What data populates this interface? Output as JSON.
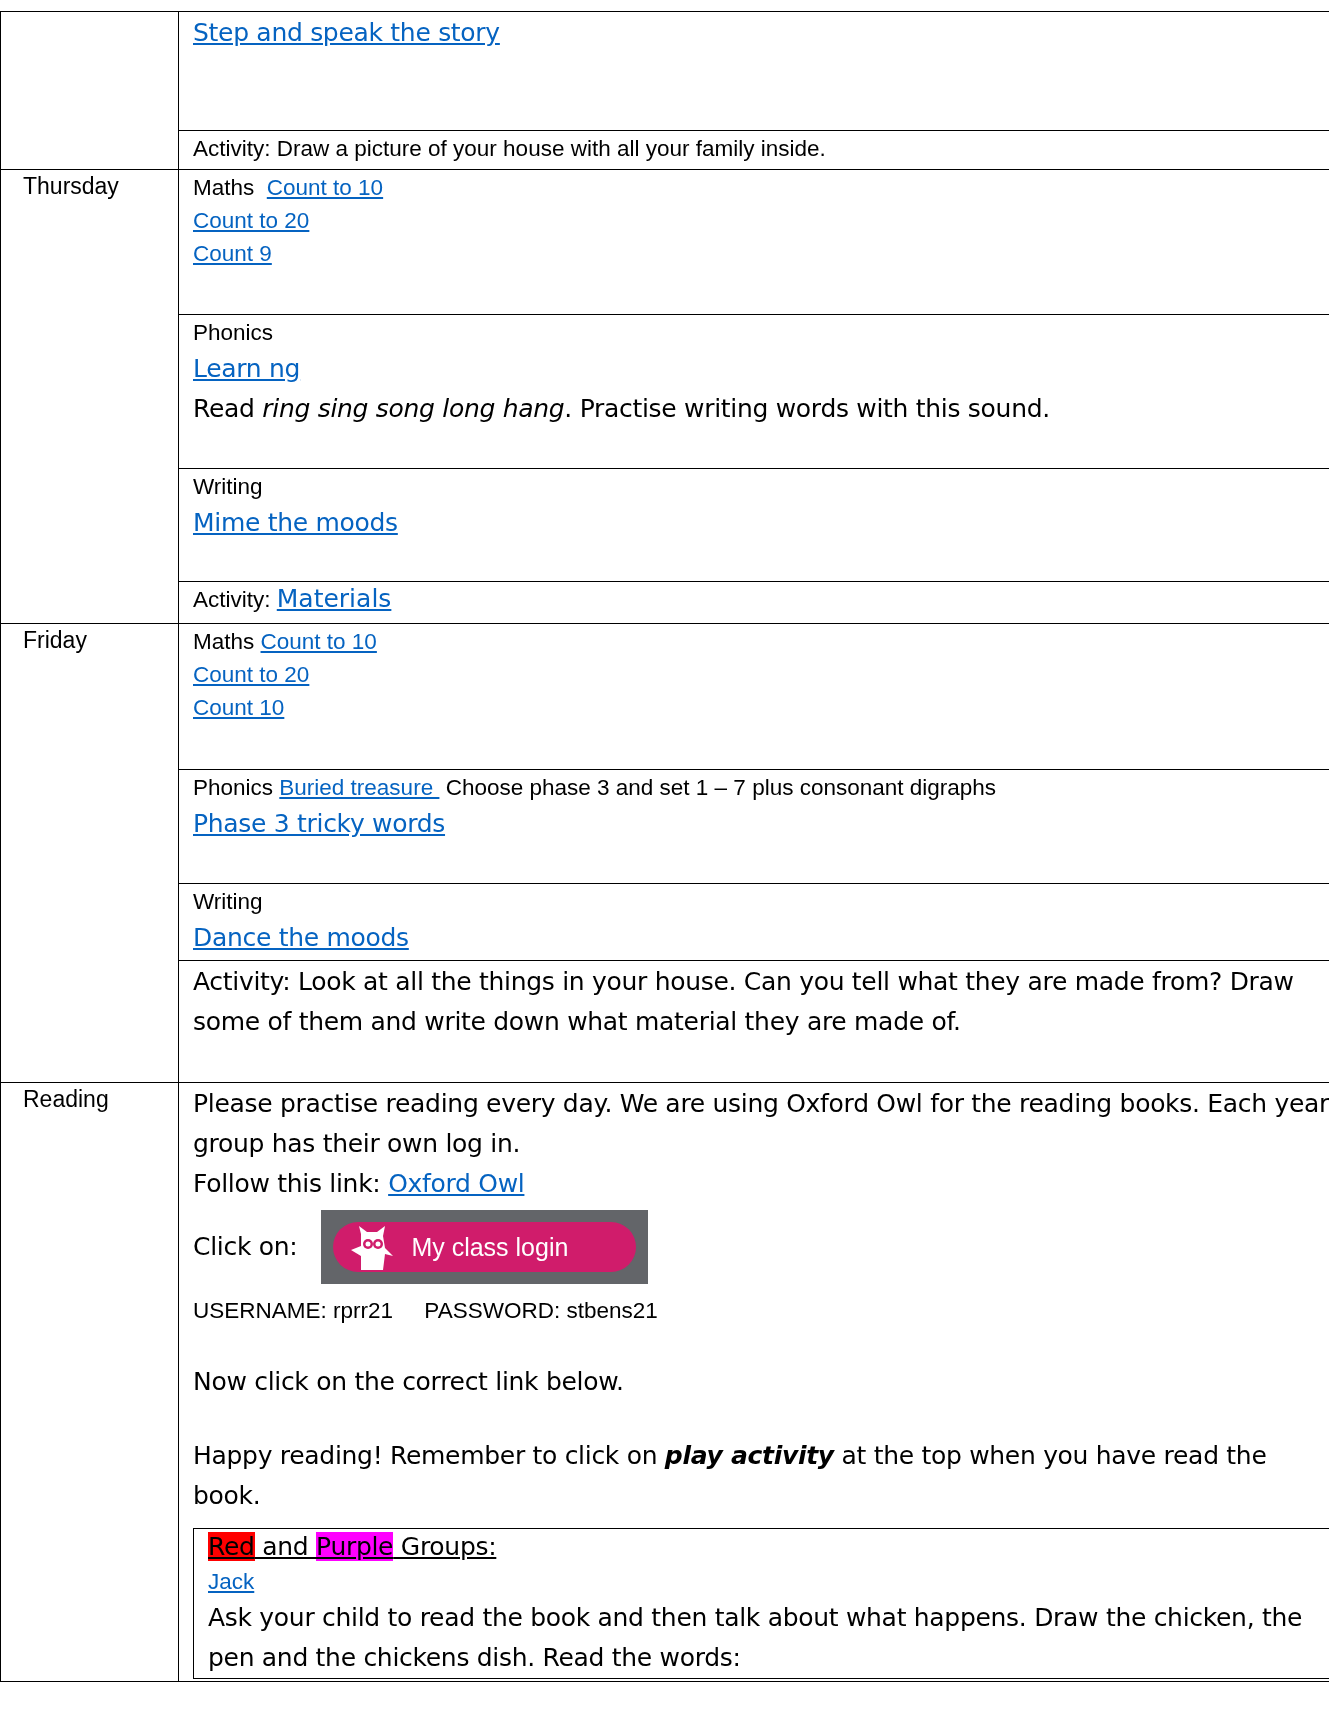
{
  "rows": [
    {
      "cells": [
        {
          "paragraphs": [
            {
              "kind": "large",
              "segments": [
                {
                  "kind": "link",
                  "text": "Step and speak the story"
                }
              ]
            }
          ]
        },
        {
          "paragraphs": [
            {
              "kind": "small",
              "segments": [
                {
                  "kind": "text",
                  "text": "Activity: Draw a picture of your house with all your family inside."
                }
              ]
            }
          ]
        }
      ]
    },
    {
      "day": "Thursday",
      "cells": [
        {
          "paragraphs": [
            {
              "kind": "small",
              "segments": [
                {
                  "kind": "text",
                  "text": "Maths  "
                },
                {
                  "kind": "link",
                  "text": "Count to 10"
                }
              ]
            },
            {
              "kind": "small",
              "segments": [
                {
                  "kind": "link",
                  "text": "Count to 20"
                }
              ]
            },
            {
              "kind": "small",
              "segments": [
                {
                  "kind": "link",
                  "text": "Count 9"
                }
              ]
            }
          ]
        },
        {
          "paragraphs": [
            {
              "kind": "small",
              "segments": [
                {
                  "kind": "text",
                  "text": "Phonics"
                }
              ]
            },
            {
              "kind": "large",
              "segments": [
                {
                  "kind": "link",
                  "text": "Learn ng"
                }
              ]
            },
            {
              "kind": "large",
              "segments": [
                {
                  "kind": "text",
                  "text": "Read "
                },
                {
                  "kind": "italic",
                  "text": "ring sing song long hang"
                },
                {
                  "kind": "text",
                  "text": ". Practise writing words with this sound."
                }
              ]
            }
          ]
        },
        {
          "paragraphs": [
            {
              "kind": "small",
              "segments": [
                {
                  "kind": "text",
                  "text": "Writing"
                }
              ]
            },
            {
              "kind": "large",
              "segments": [
                {
                  "kind": "link",
                  "text": "Mime the moods"
                }
              ]
            }
          ]
        },
        {
          "paragraphs": [
            {
              "kind": "small",
              "segments": [
                {
                  "kind": "text",
                  "text": "Activity: "
                },
                {
                  "kind": "biglink",
                  "text": "Materials"
                }
              ]
            }
          ]
        }
      ]
    },
    {
      "day": "Friday",
      "cells": [
        {
          "paragraphs": [
            {
              "kind": "small",
              "segments": [
                {
                  "kind": "text",
                  "text": "Maths "
                },
                {
                  "kind": "link",
                  "text": "Count to 10"
                }
              ]
            },
            {
              "kind": "small",
              "segments": [
                {
                  "kind": "link",
                  "text": "Count to 20"
                }
              ]
            },
            {
              "kind": "small",
              "segments": [
                {
                  "kind": "link",
                  "text": "Count 10"
                }
              ]
            }
          ]
        },
        {
          "paragraphs": [
            {
              "kind": "small",
              "segments": [
                {
                  "kind": "text",
                  "text": "Phonics "
                },
                {
                  "kind": "link",
                  "text": "Buried treasure "
                },
                {
                  "kind": "text",
                  "text": " Choose phase 3 and set 1 – 7 plus consonant digraphs"
                }
              ]
            },
            {
              "kind": "large",
              "segments": [
                {
                  "kind": "link",
                  "text": "Phase 3 tricky words"
                }
              ]
            }
          ]
        },
        {
          "paragraphs": [
            {
              "kind": "small",
              "segments": [
                {
                  "kind": "text",
                  "text": "Writing"
                }
              ]
            },
            {
              "kind": "large",
              "segments": [
                {
                  "kind": "link",
                  "text": "Dance the moods"
                }
              ]
            }
          ]
        },
        {
          "paragraphs": [
            {
              "kind": "large",
              "segments": [
                {
                  "kind": "text",
                  "text": "Activity: Look at all the things in your house. Can you tell what they are made from? Draw some of them and write down what material they are made of."
                }
              ]
            }
          ]
        }
      ]
    },
    {
      "day": "Reading",
      "cells": [
        {
          "paragraphs": [
            {
              "kind": "large",
              "segments": [
                {
                  "kind": "text",
                  "text": "Please practise reading every day. We are using Oxford Owl for the reading books. Each year group has their own log in."
                }
              ]
            },
            {
              "kind": "large",
              "segments": [
                {
                  "kind": "text",
                  "text": "Follow this link: "
                },
                {
                  "kind": "link",
                  "text": "Oxford Owl"
                }
              ]
            },
            {
              "kind": "login",
              "prompt": "Click on:",
              "button": "My class login"
            },
            {
              "kind": "small",
              "segments": [
                {
                  "kind": "text",
                  "text": "USERNAME: rprr21     PASSWORD: stbens21"
                }
              ]
            },
            {
              "kind": "large",
              "segments": [
                {
                  "kind": "text",
                  "text": "Now click on the correct link below."
                }
              ]
            },
            {
              "kind": "large",
              "segments": [
                {
                  "kind": "text",
                  "text": "Happy reading! Remember to click on "
                },
                {
                  "kind": "bolditalic",
                  "text": "play activity"
                },
                {
                  "kind": "text",
                  "text": " at the top when you have read the book."
                }
              ]
            },
            {
              "kind": "box",
              "paragraphs": [
                {
                  "kind": "heading",
                  "segments": [
                    {
                      "kind": "highlight",
                      "color": "#ff0000",
                      "text": "Red"
                    },
                    {
                      "kind": "text",
                      "text": " and "
                    },
                    {
                      "kind": "highlight",
                      "color": "#ff00ff",
                      "text": "Purple"
                    },
                    {
                      "kind": "text",
                      "text": " Groups:"
                    }
                  ]
                },
                {
                  "kind": "small",
                  "segments": [
                    {
                      "kind": "link",
                      "text": "Jack"
                    }
                  ]
                },
                {
                  "kind": "large",
                  "segments": [
                    {
                      "kind": "text",
                      "text": "Ask your child to read the book and then talk about what happens. Draw the chicken, the pen and the chickens dish. Read the words:"
                    }
                  ]
                }
              ]
            }
          ]
        }
      ]
    }
  ]
}
